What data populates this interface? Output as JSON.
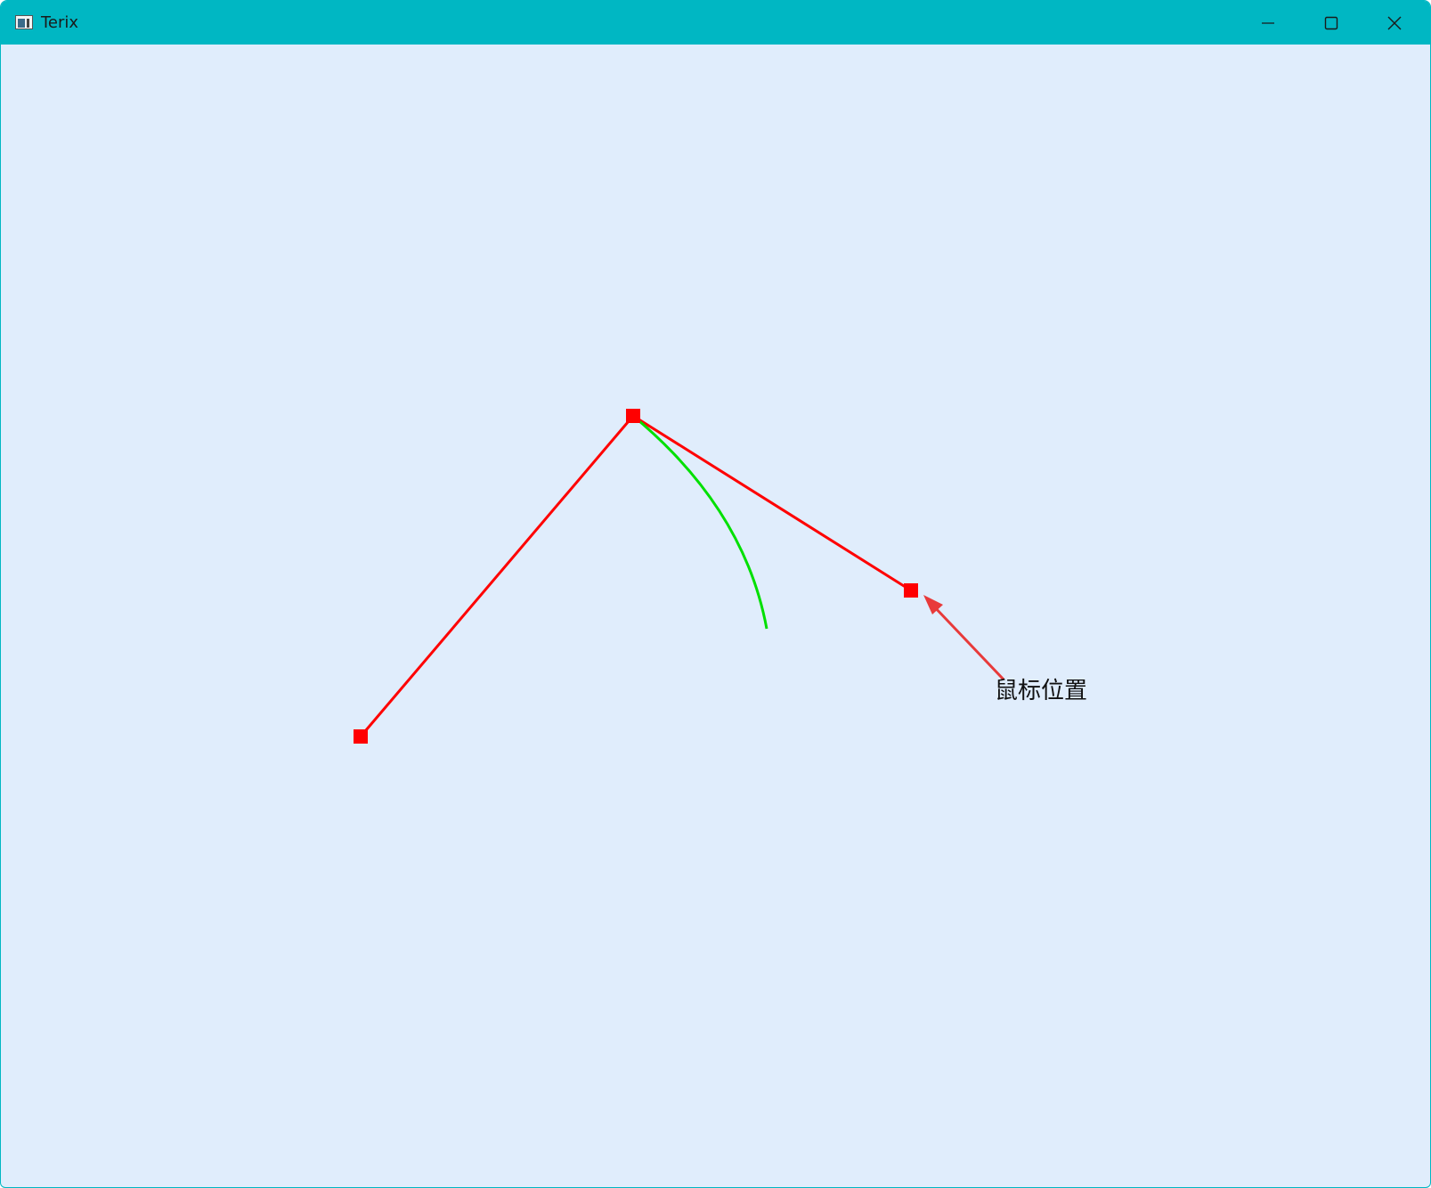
{
  "window": {
    "title": "Terix",
    "title_bar_color": "#00b7c3",
    "canvas_background": "#e0edfc"
  },
  "caption_buttons": {
    "minimize_icon": "minimize-icon",
    "maximize_icon": "maximize-icon",
    "close_icon": "close-icon"
  },
  "drawing": {
    "control_lines_color": "#ff0000",
    "curve_color": "#00e000",
    "annotation_arrow_color": "#e83a3a",
    "annotation_label": "鼠标位置"
  }
}
